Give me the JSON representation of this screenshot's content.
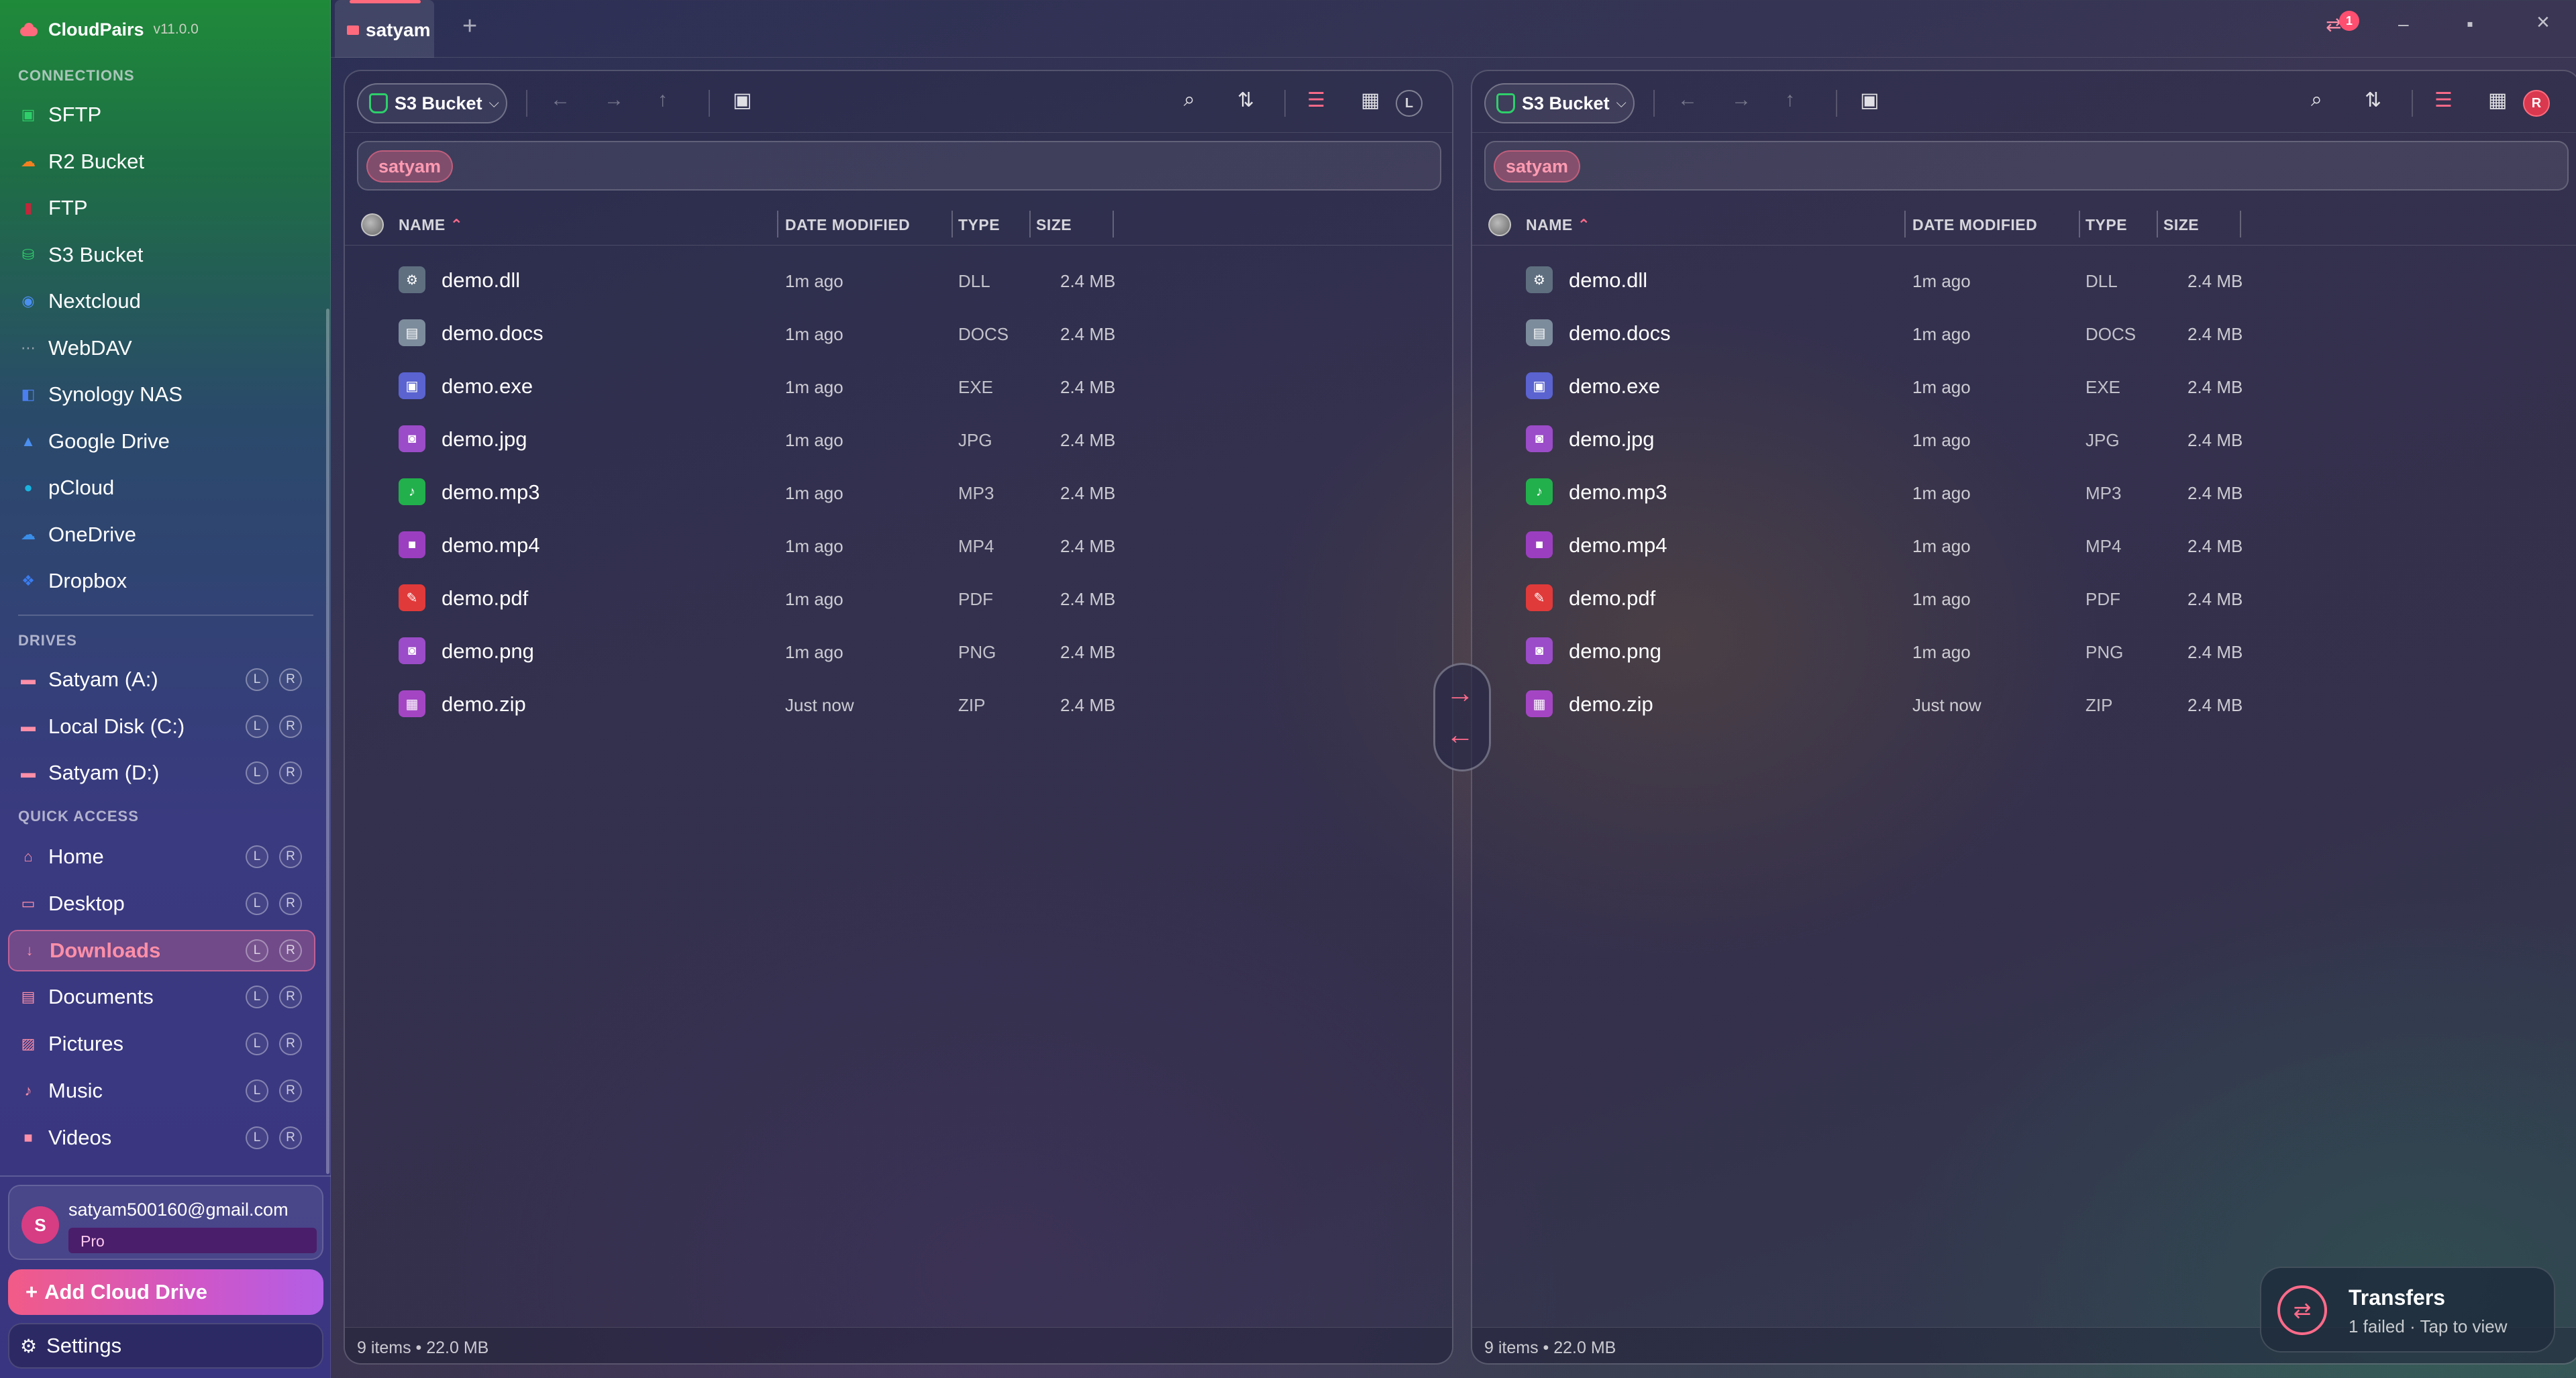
{
  "app": {
    "name": "CloudPairs",
    "version": "v11.0.0"
  },
  "sidebar": {
    "connections_label": "CONNECTIONS",
    "connections": [
      {
        "label": "SFTP",
        "icon": "sftp-icon",
        "color": "#2ecf6a"
      },
      {
        "label": "R2 Bucket",
        "icon": "r2-cloud-icon",
        "color": "#f38020"
      },
      {
        "label": "FTP",
        "icon": "ftp-icon",
        "color": "#c0283b"
      },
      {
        "label": "S3 Bucket",
        "icon": "s3-bucket-icon",
        "color": "#2ecf6a"
      },
      {
        "label": "Nextcloud",
        "icon": "nextcloud-icon",
        "color": "#4b8ff0"
      },
      {
        "label": "WebDAV",
        "icon": "webdav-icon",
        "color": "#9aa4b0"
      },
      {
        "label": "Synology NAS",
        "icon": "synology-icon",
        "color": "#4b7ef0"
      },
      {
        "label": "Google Drive",
        "icon": "google-drive-icon",
        "color": "#4b8ff0"
      },
      {
        "label": "pCloud",
        "icon": "pcloud-icon",
        "color": "#19b4e0"
      },
      {
        "label": "OneDrive",
        "icon": "onedrive-icon",
        "color": "#3a8ee8"
      },
      {
        "label": "Dropbox",
        "icon": "dropbox-icon",
        "color": "#3a7cf0"
      }
    ],
    "drives_label": "DRIVES",
    "drives": [
      {
        "label": "Satyam (A:)",
        "icon": "drive-icon"
      },
      {
        "label": "Local Disk (C:)",
        "icon": "drive-icon"
      },
      {
        "label": "Satyam (D:)",
        "icon": "drive-icon"
      }
    ],
    "quick_label": "QUICK ACCESS",
    "quick": [
      {
        "label": "Home",
        "icon": "home-icon"
      },
      {
        "label": "Desktop",
        "icon": "desktop-icon"
      },
      {
        "label": "Downloads",
        "icon": "download-icon",
        "active": true
      },
      {
        "label": "Documents",
        "icon": "document-icon"
      },
      {
        "label": "Pictures",
        "icon": "picture-icon"
      },
      {
        "label": "Music",
        "icon": "music-icon"
      },
      {
        "label": "Videos",
        "icon": "video-icon"
      }
    ],
    "lr": {
      "l": "L",
      "r": "R"
    },
    "account": {
      "initial": "S",
      "email": "satyam500160@gmail.com",
      "plan": "Pro"
    },
    "add_cloud": "Add Cloud Drive",
    "settings": "Settings"
  },
  "tabs": [
    {
      "label": "satyam"
    }
  ],
  "tab_add": "+",
  "window": {
    "transfer_badge": "1",
    "minimize": "–",
    "maximize": "▪",
    "close": "×"
  },
  "panels": [
    {
      "side_badge": "L",
      "source": "S3 Bucket",
      "breadcrumb": "satyam",
      "columns": {
        "name": "NAME",
        "date": "DATE MODIFIED",
        "type": "TYPE",
        "size": "SIZE"
      },
      "status": "9 items • 22.0 MB"
    },
    {
      "side_badge": "R",
      "source": "S3 Bucket",
      "breadcrumb": "satyam",
      "columns": {
        "name": "NAME",
        "date": "DATE MODIFIED",
        "type": "TYPE",
        "size": "SIZE"
      },
      "status": "9 items • 22.0 MB"
    }
  ],
  "files": [
    {
      "name": "demo.dll",
      "date": "1m ago",
      "type": "DLL",
      "size": "2.4 MB",
      "icon": "gear-icon",
      "color": "#5f6f80"
    },
    {
      "name": "demo.docs",
      "date": "1m ago",
      "type": "DOCS",
      "size": "2.4 MB",
      "icon": "file-icon",
      "color": "#7d8c9c"
    },
    {
      "name": "demo.exe",
      "date": "1m ago",
      "type": "EXE",
      "size": "2.4 MB",
      "icon": "app-icon",
      "color": "#5a63d0"
    },
    {
      "name": "demo.jpg",
      "date": "1m ago",
      "type": "JPG",
      "size": "2.4 MB",
      "icon": "image-icon",
      "color": "#9b4cc8"
    },
    {
      "name": "demo.mp3",
      "date": "1m ago",
      "type": "MP3",
      "size": "2.4 MB",
      "icon": "music-note-icon",
      "color": "#22b04c"
    },
    {
      "name": "demo.mp4",
      "date": "1m ago",
      "type": "MP4",
      "size": "2.4 MB",
      "icon": "video-icon",
      "color": "#9b3fc0"
    },
    {
      "name": "demo.pdf",
      "date": "1m ago",
      "type": "PDF",
      "size": "2.4 MB",
      "icon": "pdf-icon",
      "color": "#e03a3a"
    },
    {
      "name": "demo.png",
      "date": "1m ago",
      "type": "PNG",
      "size": "2.4 MB",
      "icon": "image-icon",
      "color": "#9b4cc8"
    },
    {
      "name": "demo.zip",
      "date": "Just now",
      "type": "ZIP",
      "size": "2.4 MB",
      "icon": "archive-icon",
      "color": "#a446c4"
    }
  ],
  "transfers": {
    "title": "Transfers",
    "subtitle": "1 failed · Tap to view"
  }
}
